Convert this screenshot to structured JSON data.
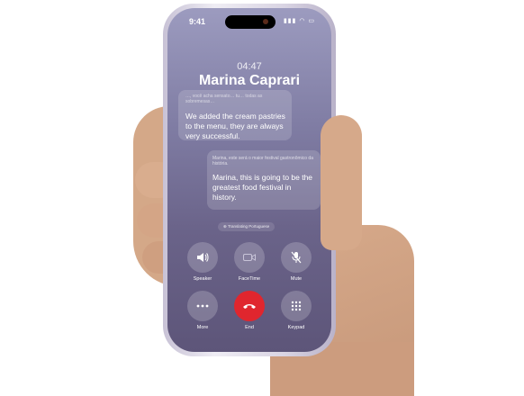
{
  "status_bar": {
    "time": "9:41",
    "icons": "▮▮▮ ◠ ▭"
  },
  "call": {
    "timer": "04:47",
    "caller_name": "Marina Caprari",
    "messages": [
      {
        "original": "…, você acha sensato… tu… todas as sobremesas…",
        "translated": "We added the cream pastries to the menu, they are always very successful."
      },
      {
        "original": "Marina, este será o maior festival gastronômico da história.",
        "translated": "Marina, this is going to be the greatest food festival in history."
      }
    ],
    "translating_label": "Translating Portuguese"
  },
  "controls": {
    "speaker": "Speaker",
    "facetime": "FaceTime",
    "mute": "Mute",
    "more": "More",
    "end": "End",
    "keypad": "Keypad"
  },
  "colors": {
    "end_button": "#e0262e",
    "screen_top": "#9c9bbf",
    "screen_bottom": "#5d5579"
  }
}
